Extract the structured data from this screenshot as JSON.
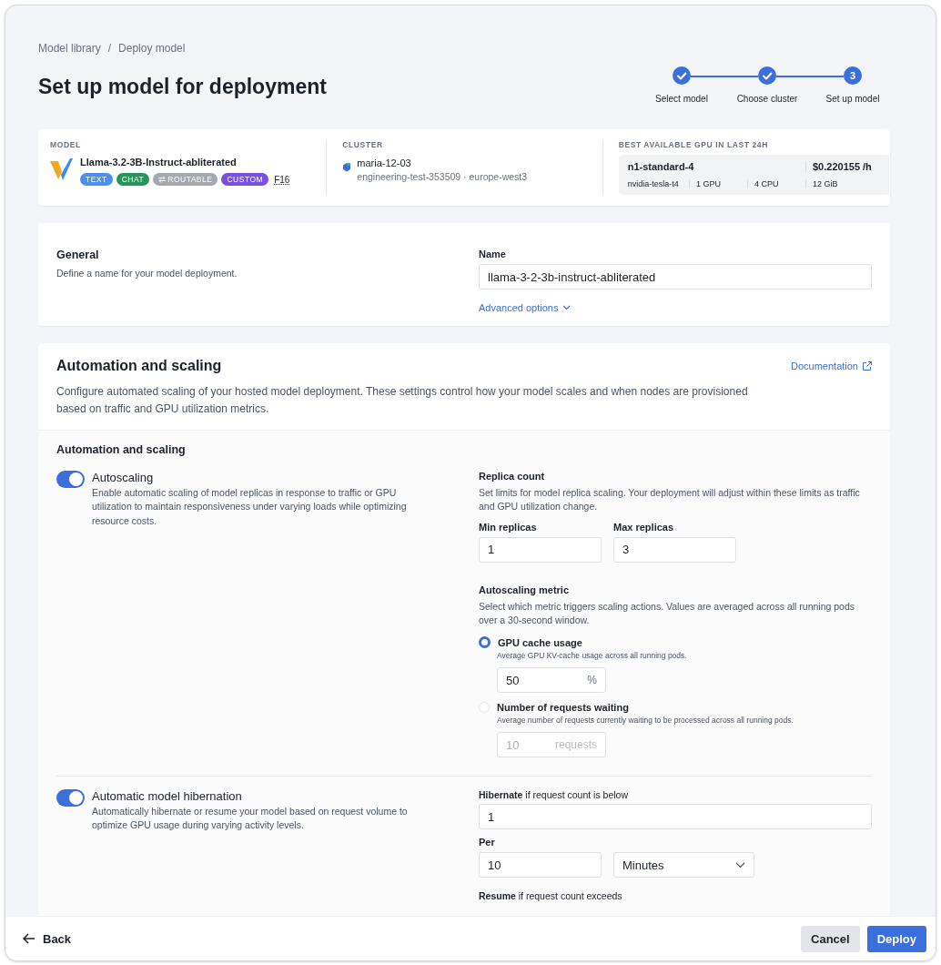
{
  "breadcrumb": [
    "Model library",
    "Deploy model"
  ],
  "breadcrumb_separator": "/",
  "title": "Set up model for deployment",
  "steps": [
    {
      "label": "Select model",
      "completed": true
    },
    {
      "label": "Choose cluster",
      "completed": true
    },
    {
      "label": "Set up model",
      "completed": false,
      "number": "3"
    }
  ],
  "summary": {
    "model": {
      "heading": "MODEL",
      "name": "Llama-3.2-3B-Instruct-abliterated",
      "tags": [
        {
          "label": "TEXT",
          "color": "#4b8ff0"
        },
        {
          "label": "CHAT",
          "color": "#25955a"
        },
        {
          "label": "ROUTABLE",
          "color": "#a4a9b0",
          "kind": "icon"
        },
        {
          "label": "CUSTOM",
          "color": "#7b4fe0"
        }
      ],
      "precision": "F16"
    },
    "cluster": {
      "heading": "CLUSTER",
      "name": "maria-12-03",
      "detail": "engineering-test-353509 · europe-west3"
    },
    "gpu": {
      "heading": "BEST AVAILABLE GPU IN LAST 24H",
      "machine": "n1-standard-4",
      "price": "$0.220155 /h",
      "specs": [
        "nvidia-tesla-t4",
        "1 GPU",
        "4 CPU",
        "12 GiB"
      ]
    }
  },
  "general": {
    "title": "General",
    "description": "Define a name for your model deployment.",
    "name_label": "Name",
    "name_value": "llama-3-2-3b-instruct-abliterated",
    "advanced": "Advanced options"
  },
  "automation": {
    "title": "Automation and scaling",
    "link": "Documentation",
    "description": "Configure automated scaling of your hosted model deployment. These settings control how your model scales and when nodes are provisioned based on traffic and GPU utilization metrics.",
    "subtitle": "Automation and scaling",
    "autoscaling": {
      "label": "Autoscaling",
      "on": true,
      "description": "Enable automatic scaling of model replicas in response to traffic or GPU utilization to maintain responsiveness under varying loads while optimizing resource costs.",
      "replica_title": "Replica count",
      "replica_description": "Set limits for model replica scaling. Your deployment will adjust within these limits as traffic and GPU utilization change.",
      "min_label": "Min replicas",
      "min_value": "1",
      "max_label": "Max replicas",
      "max_value": "3",
      "metric_title": "Autoscaling metric",
      "metric_description": "Select which metric triggers scaling actions. Values are averaged across all running pods over a 30-second window.",
      "metrics": [
        {
          "label": "GPU cache usage",
          "selected": true,
          "description": "Average GPU KV-cache usage across all running pods.",
          "value": "50",
          "unit": "%",
          "disabled": false
        },
        {
          "label": "Number of requests waiting",
          "selected": false,
          "description": "Average number of requests currently waiting to be processed across all running pods.",
          "value": "10",
          "unit": "requests",
          "disabled": true
        }
      ]
    },
    "hibernation": {
      "label": "Automatic model hibernation",
      "on": true,
      "description": "Automatically hibernate or resume your model based on request volume to optimize GPU usage during varying activity levels.",
      "below_label": "**Hibernate** if request count is below",
      "below_value": "1",
      "per_label": "Per",
      "per_value": "10",
      "unit_value": "Minutes",
      "resume_label": "**Resume** if request count exceeds"
    }
  },
  "footer": {
    "back": "Back",
    "cancel": "Cancel",
    "deploy": "Deploy"
  }
}
